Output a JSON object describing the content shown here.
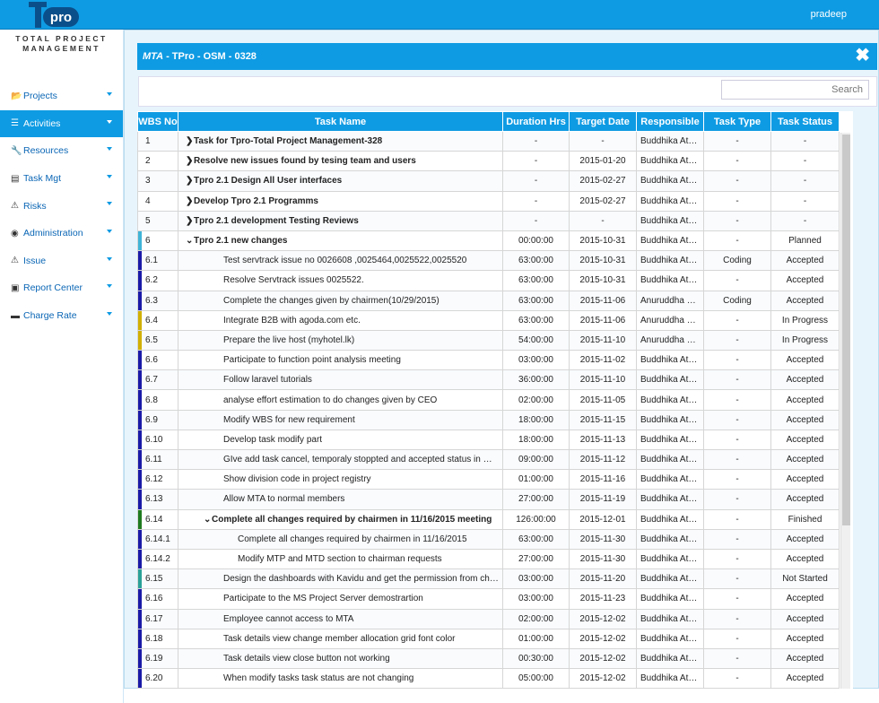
{
  "header": {
    "user": "pradeep"
  },
  "brand": {
    "logo": "Tpro",
    "subtitle": "TOTAL PROJECT MANAGEMENT"
  },
  "sidebar": {
    "items": [
      {
        "label": "Projects",
        "icon": "folder-open-icon",
        "glyph": "📂"
      },
      {
        "label": "Activities",
        "icon": "list-icon",
        "glyph": "☰",
        "active": true
      },
      {
        "label": "Resources",
        "icon": "wrench-icon",
        "glyph": "🔧"
      },
      {
        "label": "Task Mgt",
        "icon": "tasks-icon",
        "glyph": "▤"
      },
      {
        "label": "Risks",
        "icon": "warning-icon",
        "glyph": "⚠"
      },
      {
        "label": "Administration",
        "icon": "globe-icon",
        "glyph": "◉"
      },
      {
        "label": "Issue",
        "icon": "warning-icon",
        "glyph": "⚠"
      },
      {
        "label": "Report Center",
        "icon": "document-icon",
        "glyph": "▣"
      },
      {
        "label": "Charge Rate",
        "icon": "briefcase-icon",
        "glyph": "▬"
      }
    ]
  },
  "panel": {
    "title_prefix": "MTA",
    "title_rest": " - TPro - OSM - 0328",
    "search_placeholder": "Search"
  },
  "grid": {
    "columns": [
      "WBS No",
      "Task Name",
      "Duration Hrs",
      "Target Date",
      "Responsible",
      "Task Type",
      "Task Status"
    ],
    "rows": [
      {
        "wbs": "1",
        "name": "Task for Tpro-Total Project Management-328",
        "dur": "-",
        "date": "-",
        "resp": "Buddhika Ath...",
        "type": "-",
        "status": "-",
        "bold": true,
        "toggle": "❯",
        "indent": 0,
        "bar": ""
      },
      {
        "wbs": "2",
        "name": "Resolve new issues found by tesing team and users",
        "dur": "-",
        "date": "2015-01-20",
        "resp": "Buddhika Ath...",
        "type": "-",
        "status": "-",
        "bold": true,
        "toggle": "❯",
        "indent": 0,
        "bar": ""
      },
      {
        "wbs": "3",
        "name": "Tpro 2.1 Design All User interfaces",
        "dur": "-",
        "date": "2015-02-27",
        "resp": "Buddhika Ath...",
        "type": "-",
        "status": "-",
        "bold": true,
        "toggle": "❯",
        "indent": 0,
        "bar": ""
      },
      {
        "wbs": "4",
        "name": "Develop Tpro 2.1 Programms",
        "dur": "-",
        "date": "2015-02-27",
        "resp": "Buddhika Ath...",
        "type": "-",
        "status": "-",
        "bold": true,
        "toggle": "❯",
        "indent": 0,
        "bar": ""
      },
      {
        "wbs": "5",
        "name": "Tpro 2.1 development Testing Reviews",
        "dur": "-",
        "date": "-",
        "resp": "Buddhika Ath...",
        "type": "-",
        "status": "-",
        "bold": true,
        "toggle": "❯",
        "indent": 0,
        "bar": ""
      },
      {
        "wbs": "6",
        "name": "Tpro 2.1 new changes",
        "dur": "00:00:00",
        "date": "2015-10-31",
        "resp": "Buddhika Ath...",
        "type": "-",
        "status": "Planned",
        "bold": true,
        "toggle": "⌄",
        "indent": 0,
        "bar": "#3fb3d6"
      },
      {
        "wbs": "6.1",
        "name": "Test servtrack issue no 0026608 ,0025464,0025522,0025520",
        "dur": "63:00:00",
        "date": "2015-10-31",
        "resp": "Buddhika Ath...",
        "type": "Coding",
        "status": "Accepted",
        "indent": 1,
        "bar": "#1a1aa8"
      },
      {
        "wbs": "6.2",
        "name": "Resolve Servtrack issues 0025522.",
        "dur": "63:00:00",
        "date": "2015-10-31",
        "resp": "Buddhika Ath...",
        "type": "-",
        "status": "Accepted",
        "indent": 1,
        "bar": "#1a1aa8"
      },
      {
        "wbs": "6.3",
        "name": "Complete the changes given by chairmen(10/29/2015)",
        "dur": "63:00:00",
        "date": "2015-11-06",
        "resp": "Anuruddha R...",
        "type": "Coding",
        "status": "Accepted",
        "indent": 1,
        "bar": "#1a1aa8"
      },
      {
        "wbs": "6.4",
        "name": "Integrate B2B with agoda.com etc.",
        "dur": "63:00:00",
        "date": "2015-11-06",
        "resp": "Anuruddha R...",
        "type": "-",
        "status": "In Progress",
        "indent": 1,
        "bar": "#d1b000"
      },
      {
        "wbs": "6.5",
        "name": "Prepare the live host (myhotel.lk)",
        "dur": "54:00:00",
        "date": "2015-11-10",
        "resp": "Anuruddha R...",
        "type": "-",
        "status": "In Progress",
        "indent": 1,
        "bar": "#d1b000"
      },
      {
        "wbs": "6.6",
        "name": "Participate to function point analysis meeting",
        "dur": "03:00:00",
        "date": "2015-11-02",
        "resp": "Buddhika Ath...",
        "type": "-",
        "status": "Accepted",
        "indent": 1,
        "bar": "#1a1aa8"
      },
      {
        "wbs": "6.7",
        "name": "Follow laravel tutorials",
        "dur": "36:00:00",
        "date": "2015-11-10",
        "resp": "Buddhika Ath...",
        "type": "-",
        "status": "Accepted",
        "indent": 1,
        "bar": "#1a1aa8"
      },
      {
        "wbs": "6.8",
        "name": "analyse effort estimation to do changes given by CEO",
        "dur": "02:00:00",
        "date": "2015-11-05",
        "resp": "Buddhika Ath...",
        "type": "-",
        "status": "Accepted",
        "indent": 1,
        "bar": "#1a1aa8"
      },
      {
        "wbs": "6.9",
        "name": "Modify WBS for new requirement",
        "dur": "18:00:00",
        "date": "2015-11-15",
        "resp": "Buddhika Ath...",
        "type": "-",
        "status": "Accepted",
        "indent": 1,
        "bar": "#1a1aa8"
      },
      {
        "wbs": "6.10",
        "name": "Develop task modify part",
        "dur": "18:00:00",
        "date": "2015-11-13",
        "resp": "Buddhika Ath...",
        "type": "-",
        "status": "Accepted",
        "indent": 1,
        "bar": "#1a1aa8"
      },
      {
        "wbs": "6.11",
        "name": "GIve add task cancel, temporaly stoppted and accepted status in MTA",
        "dur": "09:00:00",
        "date": "2015-11-12",
        "resp": "Buddhika Ath...",
        "type": "-",
        "status": "Accepted",
        "indent": 1,
        "bar": "#1a1aa8"
      },
      {
        "wbs": "6.12",
        "name": "Show division code in project registry",
        "dur": "01:00:00",
        "date": "2015-11-16",
        "resp": "Buddhika Ath...",
        "type": "-",
        "status": "Accepted",
        "indent": 1,
        "bar": "#1a1aa8"
      },
      {
        "wbs": "6.13",
        "name": "Allow MTA to normal members",
        "dur": "27:00:00",
        "date": "2015-11-19",
        "resp": "Buddhika Ath...",
        "type": "-",
        "status": "Accepted",
        "indent": 1,
        "bar": "#1a1aa8"
      },
      {
        "wbs": "6.14",
        "name": "Complete all changes required by chairmen in 11/16/2015 meeting",
        "dur": "126:00:00",
        "date": "2015-12-01",
        "resp": "Buddhika Ath...",
        "type": "-",
        "status": "Finished",
        "bold": true,
        "toggle": "⌄",
        "indent": 1,
        "bar": "#1f7a1f"
      },
      {
        "wbs": "6.14.1",
        "name": "Complete all changes required by chairmen in 11/16/2015",
        "dur": "63:00:00",
        "date": "2015-11-30",
        "resp": "Buddhika Ath...",
        "type": "-",
        "status": "Accepted",
        "indent": 2,
        "bar": "#1a1aa8"
      },
      {
        "wbs": "6.14.2",
        "name": "Modify MTP and MTD section to chairman requests",
        "dur": "27:00:00",
        "date": "2015-11-30",
        "resp": "Buddhika Ath...",
        "type": "-",
        "status": "Accepted",
        "indent": 2,
        "bar": "#1a1aa8"
      },
      {
        "wbs": "6.15",
        "name": "Design the dashboards with Kavidu and get the permission from chairmen",
        "dur": "03:00:00",
        "date": "2015-11-20",
        "resp": "Buddhika Ath...",
        "type": "-",
        "status": "Not Started",
        "indent": 1,
        "bar": "#2aa198"
      },
      {
        "wbs": "6.16",
        "name": "Participate to the MS Project Server demostrartion",
        "dur": "03:00:00",
        "date": "2015-11-23",
        "resp": "Buddhika Ath...",
        "type": "-",
        "status": "Accepted",
        "indent": 1,
        "bar": "#1a1aa8"
      },
      {
        "wbs": "6.17",
        "name": "Employee cannot access to MTA",
        "dur": "02:00:00",
        "date": "2015-12-02",
        "resp": "Buddhika Ath...",
        "type": "-",
        "status": "Accepted",
        "indent": 1,
        "bar": "#1a1aa8"
      },
      {
        "wbs": "6.18",
        "name": "Task details view change member allocation grid font color",
        "dur": "01:00:00",
        "date": "2015-12-02",
        "resp": "Buddhika Ath...",
        "type": "-",
        "status": "Accepted",
        "indent": 1,
        "bar": "#1a1aa8"
      },
      {
        "wbs": "6.19",
        "name": "Task details view close button not working",
        "dur": "00:30:00",
        "date": "2015-12-02",
        "resp": "Buddhika Ath...",
        "type": "-",
        "status": "Accepted",
        "indent": 1,
        "bar": "#1a1aa8"
      },
      {
        "wbs": "6.20",
        "name": "When modify tasks task status are not changing",
        "dur": "05:00:00",
        "date": "2015-12-02",
        "resp": "Buddhika Ath...",
        "type": "-",
        "status": "Accepted",
        "indent": 1,
        "bar": "#1a1aa8"
      }
    ]
  }
}
